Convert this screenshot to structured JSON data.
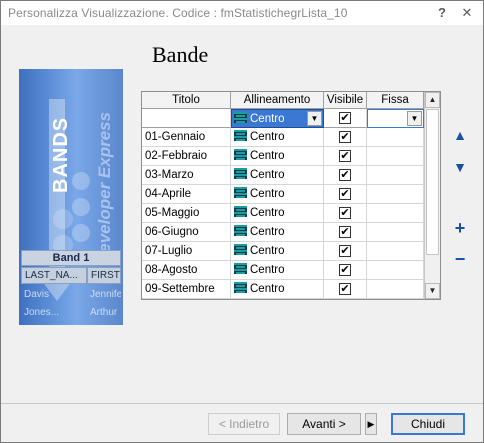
{
  "window": {
    "title": "Personalizza Visualizzazione. Codice : fmStatistichegrLista_10",
    "help_glyph": "?",
    "close_glyph": "✕"
  },
  "banner": {
    "bands_text": "BANDS",
    "brand_text": "Developer Express",
    "band_label": "Band 1",
    "grid": {
      "headers": [
        "LAST_NA...",
        "FIRST"
      ],
      "rows": [
        [
          "Davis",
          "Jennife"
        ],
        [
          "Jones...",
          "Arthur"
        ]
      ]
    }
  },
  "page_title": "Bande",
  "grid": {
    "columns": [
      "Titolo",
      "Allineamento",
      "Visibile",
      "Fissa"
    ],
    "filter_row": {
      "align_value": "Centro",
      "visible": "✔",
      "dropdown_glyph": "▼"
    },
    "rows": [
      {
        "title": "01-Gennaio",
        "align": "Centro",
        "visible": "✔",
        "fixed": ""
      },
      {
        "title": "02-Febbraio",
        "align": "Centro",
        "visible": "✔",
        "fixed": ""
      },
      {
        "title": "03-Marzo",
        "align": "Centro",
        "visible": "✔",
        "fixed": ""
      },
      {
        "title": "04-Aprile",
        "align": "Centro",
        "visible": "✔",
        "fixed": ""
      },
      {
        "title": "05-Maggio",
        "align": "Centro",
        "visible": "✔",
        "fixed": ""
      },
      {
        "title": "06-Giugno",
        "align": "Centro",
        "visible": "✔",
        "fixed": ""
      },
      {
        "title": "07-Luglio",
        "align": "Centro",
        "visible": "✔",
        "fixed": ""
      },
      {
        "title": "08-Agosto",
        "align": "Centro",
        "visible": "✔",
        "fixed": ""
      },
      {
        "title": "09-Settembre",
        "align": "Centro",
        "visible": "✔",
        "fixed": ""
      }
    ],
    "scroll_up_glyph": "▲",
    "scroll_down_glyph": "▼"
  },
  "side_buttons": {
    "move_up": "▲",
    "move_down": "▼",
    "add": "+",
    "remove": "−"
  },
  "footer": {
    "back_label": "< Indietro",
    "next_label": "Avanti >",
    "finish_glyph": "▶",
    "close_label": "Chiudi"
  },
  "colors": {
    "selection": "#3b78d4",
    "side_button_icon": "#1a4fa6",
    "banner_blue": "#5d8fd8"
  }
}
